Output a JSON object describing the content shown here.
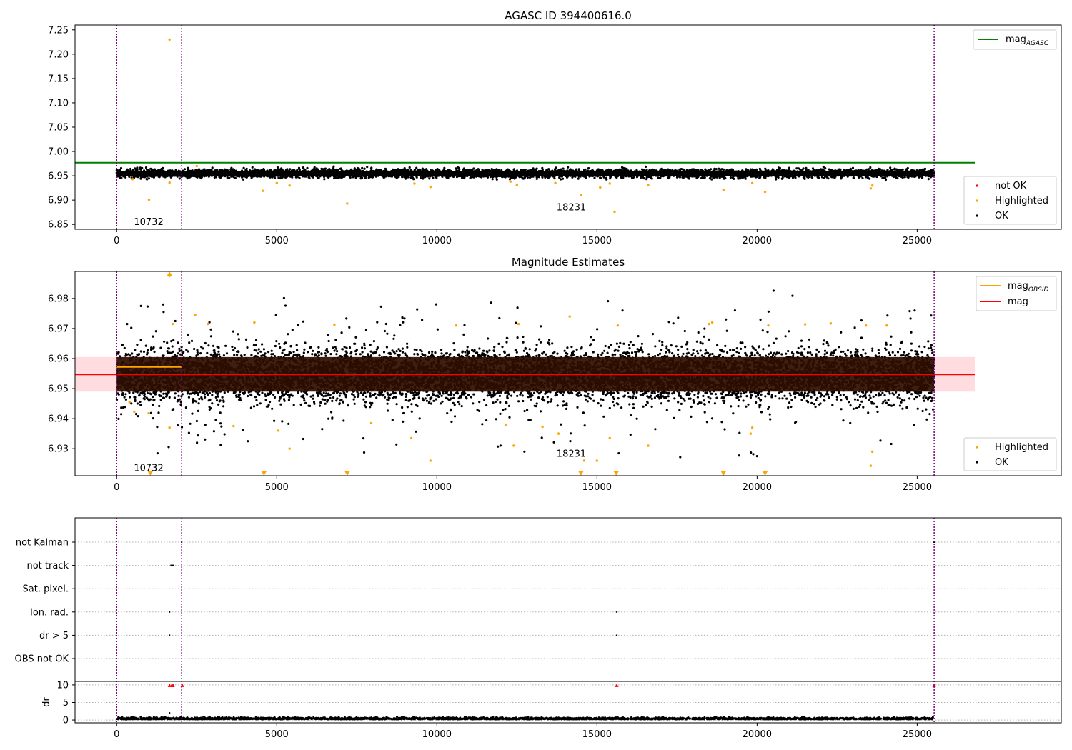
{
  "chart_data": [
    {
      "type": "scatter",
      "title": "AGASC ID 394400616.0",
      "xlim": [
        -1300,
        29500
      ],
      "ylim": [
        6.84,
        7.26
      ],
      "xticks": [
        0,
        5000,
        10000,
        15000,
        20000,
        25000
      ],
      "yticks": [
        6.85,
        6.9,
        6.95,
        7.0,
        7.05,
        7.1,
        7.15,
        7.2,
        7.25
      ],
      "ytick_labels": [
        "6.85",
        "6.90",
        "6.95",
        "7.00",
        "7.05",
        "7.10",
        "7.15",
        "7.20",
        "7.25"
      ],
      "vlines": [
        0,
        2030,
        25530
      ],
      "obsid_labels": [
        {
          "x": 1000,
          "y": 6.855,
          "text": "10732"
        },
        {
          "x": 14200,
          "y": 6.885,
          "text": "18231"
        }
      ],
      "hline": {
        "name": "mag_AGASC",
        "y": 6.977,
        "x_end": 26800
      },
      "ok_band": {
        "x_start": 0,
        "x_end": 25530,
        "center": 6.955,
        "half_width": 0.008
      },
      "series": [
        {
          "name": "not OK",
          "color": "#ff0000",
          "x": [],
          "y": []
        },
        {
          "name": "Highlighted",
          "color": "#ffa500",
          "x": [
            1650,
            1010,
            1650,
            2500,
            4560,
            5000,
            5400,
            7200,
            9300,
            9800,
            12300,
            12500,
            13700,
            14500,
            15100,
            15400,
            15550,
            16600,
            18950,
            19850,
            20250,
            23550,
            23600,
            500
          ],
          "y": [
            7.23,
            6.901,
            6.936,
            6.97,
            6.919,
            6.935,
            6.93,
            6.893,
            6.934,
            6.927,
            6.938,
            6.931,
            6.935,
            6.911,
            6.926,
            6.934,
            6.876,
            6.931,
            6.921,
            6.935,
            6.917,
            6.924,
            6.93,
            6.943
          ]
        },
        {
          "name": "OK",
          "color": "#000000",
          "x": [],
          "y": []
        }
      ],
      "legend_top": [
        "mag_AGASC"
      ],
      "legend_bottom": [
        "not OK",
        "Highlighted",
        "OK"
      ]
    },
    {
      "type": "scatter",
      "title": "Magnitude Estimates",
      "xlim": [
        -1300,
        29500
      ],
      "ylim": [
        6.921,
        6.989
      ],
      "xticks": [
        0,
        5000,
        10000,
        15000,
        20000,
        25000
      ],
      "yticks": [
        6.93,
        6.94,
        6.95,
        6.96,
        6.97,
        6.98
      ],
      "ytick_labels": [
        "6.93",
        "6.94",
        "6.95",
        "6.96",
        "6.97",
        "6.98"
      ],
      "vlines": [
        0,
        2030,
        25530
      ],
      "obsid_labels": [
        {
          "x": 1000,
          "y": 6.9235,
          "text": "10732"
        },
        {
          "x": 14200,
          "y": 6.9282,
          "text": "18231"
        }
      ],
      "mag_band": {
        "low": 6.949,
        "high": 6.9605,
        "x_end": 26800
      },
      "lines": [
        {
          "name": "mag_OBSID",
          "color": "#ffa500",
          "x": [
            0,
            2030
          ],
          "y": [
            6.9572,
            6.9572
          ]
        },
        {
          "name": "mag",
          "color": "#ff0000",
          "x": [
            -1300,
            26800
          ],
          "y": [
            6.9547,
            6.9547
          ]
        }
      ],
      "ok_band": {
        "x_start": 0,
        "x_end": 25530,
        "center": 6.9545,
        "half_width": 0.0075
      },
      "series": [
        {
          "name": "Highlighted",
          "color": "#ffa500",
          "x": [
            1650,
            400,
            550,
            1000,
            1650,
            1750,
            2450,
            2850,
            3650,
            4300,
            5050,
            5400,
            6800,
            7950,
            9200,
            9800,
            10600,
            12150,
            12400,
            12550,
            13300,
            13800,
            14150,
            14600,
            15000,
            15400,
            15650,
            16600,
            18500,
            18600,
            19800,
            19850,
            20350,
            21500,
            22300,
            23400,
            23550,
            23600,
            24050
          ],
          "y": [
            6.9875,
            6.9455,
            6.9423,
            6.9418,
            6.937,
            6.9715,
            6.9745,
            6.9715,
            6.9375,
            6.972,
            6.936,
            6.93,
            6.9713,
            6.9385,
            6.9335,
            6.926,
            6.971,
            6.938,
            6.931,
            6.9715,
            6.9373,
            6.935,
            6.974,
            6.926,
            6.926,
            6.9335,
            6.971,
            6.931,
            6.9715,
            6.972,
            6.935,
            6.937,
            6.971,
            6.9714,
            6.9717,
            6.971,
            6.9243,
            6.929,
            6.971
          ]
        },
        {
          "name": "OK",
          "color": "#000000",
          "x": [],
          "y": []
        }
      ],
      "below_markers_x": [
        1050,
        4600,
        7200,
        14500,
        15600,
        18950,
        20250
      ],
      "legend_top": [
        "mag_OBSID",
        "mag"
      ],
      "legend_bottom": [
        "Highlighted",
        "OK"
      ]
    },
    {
      "type": "scatter",
      "title": "",
      "xlim": [
        -1300,
        29500
      ],
      "xticks": [
        0,
        5000,
        10000,
        15000,
        20000,
        25000
      ],
      "vlines": [
        0,
        2030,
        25530
      ],
      "flag_rows": [
        "not Kalman",
        "not track",
        "Sat. pixel.",
        "Ion. rad.",
        "dr > 5",
        "OBS not OK"
      ],
      "flag_points": [
        {
          "row": "not track",
          "x": [
            1700,
            1740,
            1780
          ]
        },
        {
          "row": "Ion. rad.",
          "x": [
            1650,
            15620
          ]
        },
        {
          "row": "dr > 5",
          "x": [
            1650,
            15620
          ]
        },
        {
          "row": "not Kalman",
          "x": [
            2030,
            25530
          ]
        }
      ],
      "dr": {
        "ylabel": "dr",
        "yticks": [
          0,
          5,
          10
        ],
        "ytick_labels": [
          "0",
          "5",
          "10"
        ],
        "ylim": [
          -0.8,
          11
        ],
        "baseline_range": [
          0,
          1
        ],
        "clipped_markers_x": [
          1650,
          1720,
          1760,
          2050,
          15620,
          25530
        ],
        "points": [
          {
            "x": 1650,
            "y": 2
          },
          {
            "x": 2700,
            "y": 1
          }
        ]
      }
    }
  ]
}
